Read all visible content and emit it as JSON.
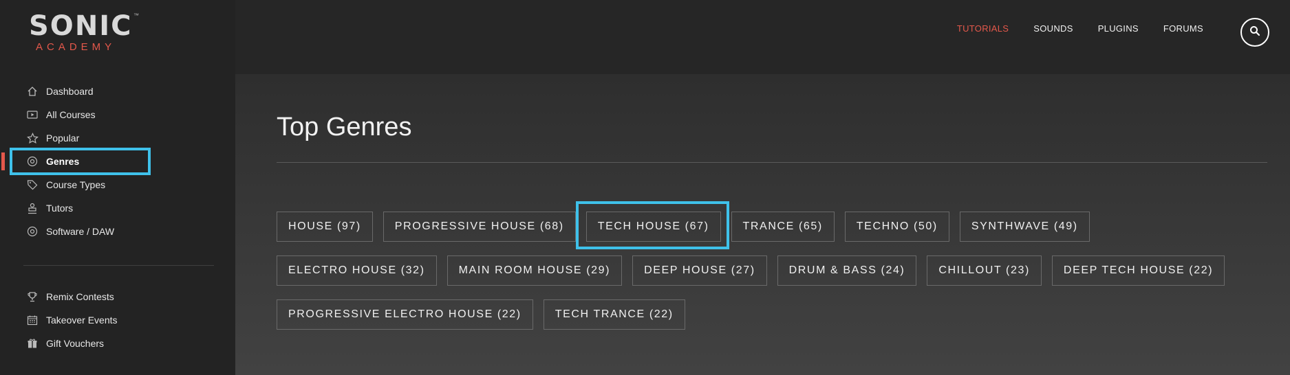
{
  "brand": {
    "main": "SONIC",
    "sub": "ACADEMY",
    "tm": "™",
    "accent_color": "#e4584b",
    "highlight_color": "#3fc1ea"
  },
  "sidebar": {
    "items": [
      {
        "label": "Dashboard",
        "icon": "home-icon"
      },
      {
        "label": "All Courses",
        "icon": "play-box-icon"
      },
      {
        "label": "Popular",
        "icon": "star-icon"
      },
      {
        "label": "Genres",
        "icon": "record-icon",
        "active": true
      },
      {
        "label": "Course Types",
        "icon": "tag-icon"
      },
      {
        "label": "Tutors",
        "icon": "tutor-icon"
      },
      {
        "label": "Software / DAW",
        "icon": "disc-icon"
      }
    ],
    "secondary": [
      {
        "label": "Remix Contests",
        "icon": "trophy-icon"
      },
      {
        "label": "Takeover Events",
        "icon": "calendar-icon"
      },
      {
        "label": "Gift Vouchers",
        "icon": "gift-icon"
      }
    ]
  },
  "header": {
    "nav": [
      {
        "label": "TUTORIALS",
        "active": true
      },
      {
        "label": "SOUNDS"
      },
      {
        "label": "PLUGINS"
      },
      {
        "label": "FORUMS"
      }
    ],
    "search_icon": "search-icon"
  },
  "main": {
    "title": "Top Genres",
    "genres": [
      [
        "HOUSE (97)",
        "PROGRESSIVE HOUSE (68)",
        "TECH HOUSE (67)",
        "TRANCE (65)",
        "TECHNO (50)",
        "SYNTHWAVE (49)"
      ],
      [
        "ELECTRO HOUSE (32)",
        "MAIN ROOM HOUSE (29)",
        "DEEP HOUSE (27)",
        "DRUM & BASS (24)",
        "CHILLOUT (23)",
        "DEEP TECH HOUSE (22)"
      ],
      [
        "PROGRESSIVE ELECTRO HOUSE (22)",
        "TECH TRANCE (22)"
      ]
    ],
    "selected_genre": "TECH HOUSE (67)"
  }
}
